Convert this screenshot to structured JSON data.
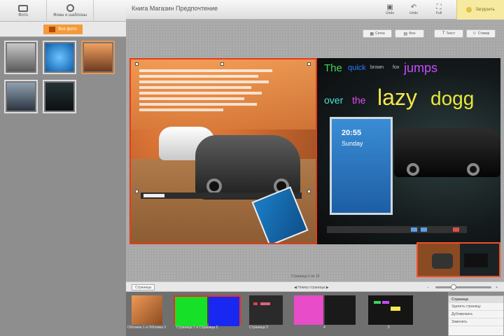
{
  "left_toolbar": {
    "photos_label": "Фото",
    "backgrounds_label": "Фоны и шаблоны"
  },
  "pictures_tab": {
    "label": "Все фото"
  },
  "thumbnails": [
    {
      "name": "thumb-car-gray"
    },
    {
      "name": "thumb-blue-phone"
    },
    {
      "name": "thumb-car-orange"
    },
    {
      "name": "thumb-car-silver"
    },
    {
      "name": "thumb-car-dark"
    }
  ],
  "top_bar": {
    "title": "Книга Магазин Предпочтение",
    "buttons": [
      {
        "label": "Undo",
        "icon": "save-icon"
      },
      {
        "label": "Undo",
        "icon": "undo-icon"
      },
      {
        "label": "Full",
        "icon": "fullscreen-icon"
      }
    ],
    "upload_label": "Загрузить"
  },
  "edit_toolbar": {
    "buttons": [
      "Сетка",
      "Фон",
      "Текст",
      "Стикер"
    ]
  },
  "page_right": {
    "words": [
      {
        "text": "The",
        "color": "#3fd35a"
      },
      {
        "text": "quick",
        "color": "#2a7cff"
      },
      {
        "text": "brown",
        "color": "#c8c8c8"
      },
      {
        "text": "fox",
        "color": "#c8c8c8"
      },
      {
        "text": "jumps",
        "color": "#c64cff"
      },
      {
        "text": "over",
        "color": "#45e5d0"
      },
      {
        "text": "the",
        "color": "#e04cf0"
      },
      {
        "text": "lazy",
        "color": "#f7e84a"
      },
      {
        "text": "dogg",
        "color": "#e8e83a"
      }
    ],
    "phone_time": "20:55",
    "phone_date": "Sunday"
  },
  "caption": "Страница 2 из 10",
  "strip_bar": {
    "pages_label": "Страницы",
    "page_number_label": "Номер страницы",
    "zoom_level": 0.3
  },
  "spreads": [
    {
      "label": "Обложка 1 и Обложка 2"
    },
    {
      "label": "Страница 1 и Страница 2"
    },
    {
      "label": "Страница 3"
    },
    {
      "label": "4"
    },
    {
      "label": "5"
    }
  ],
  "page_props": {
    "header": "Страница",
    "rows": [
      "Удалить страницу",
      "Дублировать",
      "Заменить"
    ]
  }
}
